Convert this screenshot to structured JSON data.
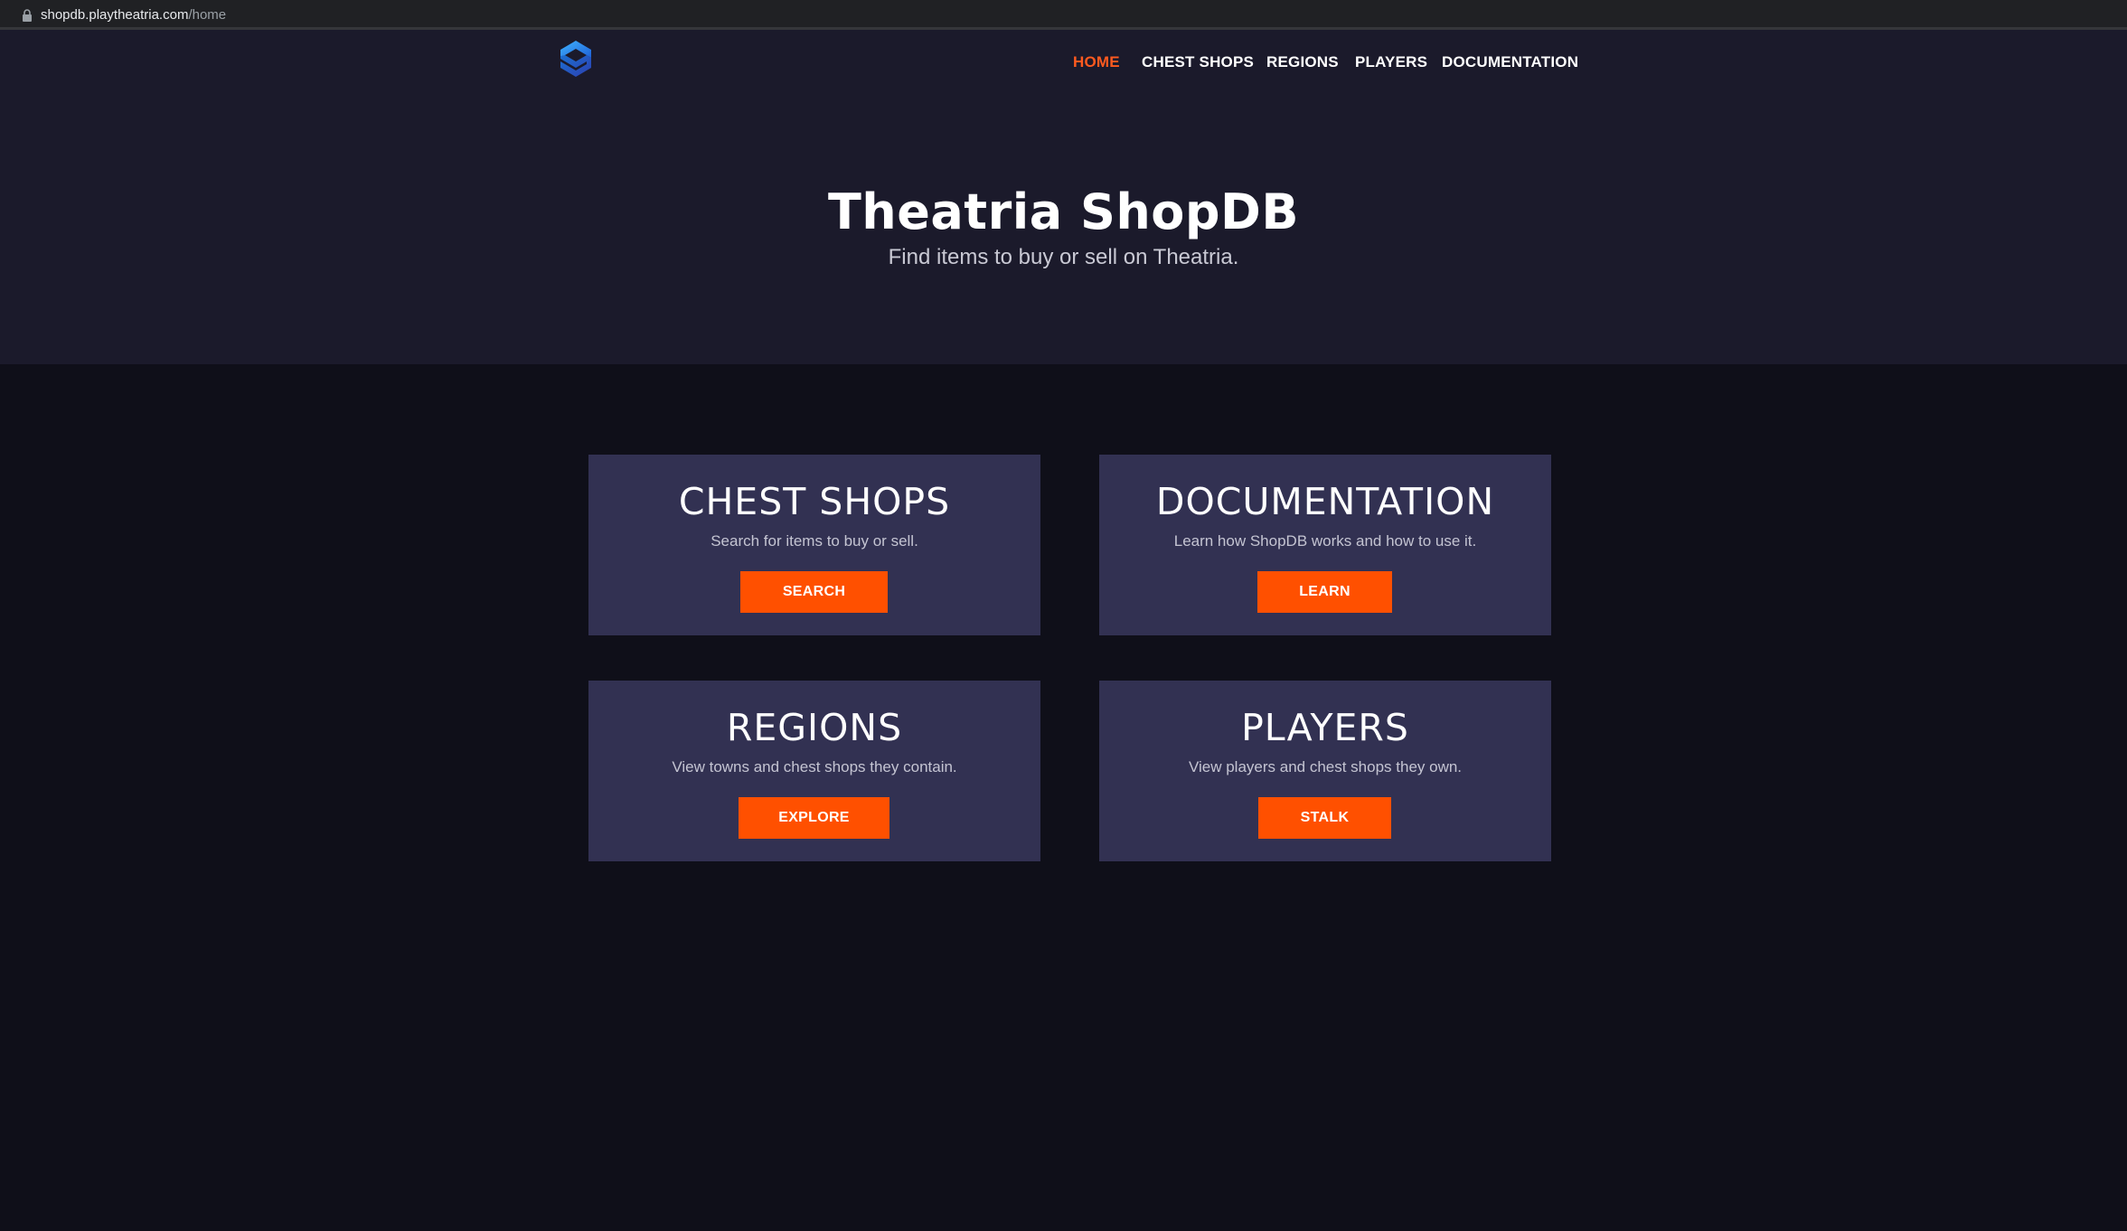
{
  "browser": {
    "url_host": "shopdb.playtheatria.com",
    "url_path": "/home"
  },
  "nav": {
    "logo_icon": "shopdb-s-logo-icon",
    "items": [
      {
        "label": "HOME",
        "active": true
      },
      {
        "label": "CHEST SHOPS",
        "active": false
      },
      {
        "label": "REGIONS",
        "active": false
      },
      {
        "label": "PLAYERS",
        "active": false
      },
      {
        "label": "DOCUMENTATION",
        "active": false
      }
    ]
  },
  "hero": {
    "title": "Theatria ShopDB",
    "subtitle": "Find items to buy or sell on Theatria."
  },
  "cards": [
    {
      "title": "CHEST SHOPS",
      "description": "Search for items to buy or sell.",
      "button": "SEARCH"
    },
    {
      "title": "DOCUMENTATION",
      "description": "Learn how ShopDB works and how to use it.",
      "button": "LEARN"
    },
    {
      "title": "REGIONS",
      "description": "View towns and chest shops they contain.",
      "button": "EXPLORE"
    },
    {
      "title": "PLAYERS",
      "description": "View players and chest shops they own.",
      "button": "STALK"
    }
  ],
  "colors": {
    "accent": "#ff5000",
    "hero_bg": "#1b1a2b",
    "page_bg": "#0f0f19",
    "card_bg": "#323152"
  }
}
